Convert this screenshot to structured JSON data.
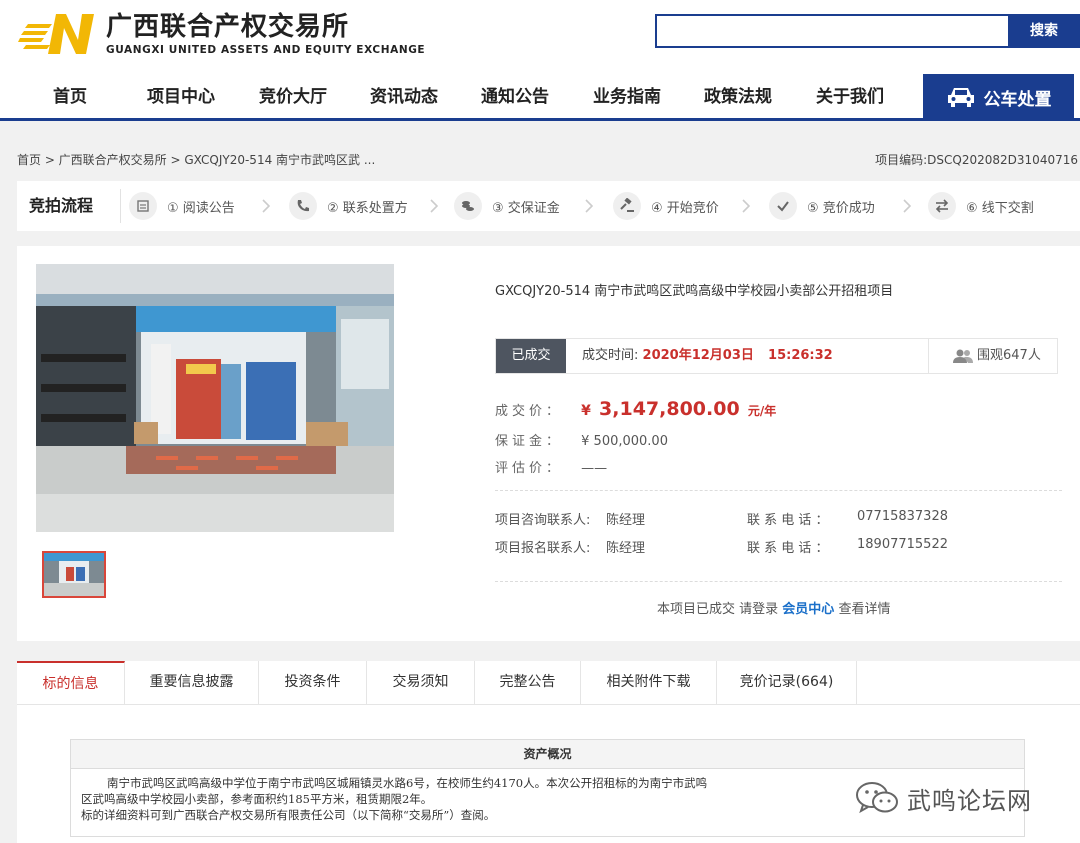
{
  "header": {
    "logo_cn": "广西联合产权交易所",
    "logo_en": "GUANGXI UNITED ASSETS AND EQUITY EXCHANGE",
    "search_placeholder": "",
    "search_button": "搜索"
  },
  "nav": {
    "items": [
      "首页",
      "项目中心",
      "竞价大厅",
      "资讯动态",
      "通知公告",
      "业务指南",
      "政策法规",
      "关于我们"
    ],
    "special": "公车处置"
  },
  "breadcrumb": "首页 > 广西联合产权交易所 > GXCQJY20-514 南宁市武鸣区武 ...",
  "project_code": "项目编码:DSCQ202082D31040716",
  "process": {
    "title": "竞拍流程",
    "steps": [
      "① 阅读公告",
      "② 联系处置方",
      "③ 交保证金",
      "④ 开始竞价",
      "⑤ 竞价成功",
      "⑥ 线下交割"
    ]
  },
  "project": {
    "title": "GXCQJY20-514 南宁市武鸣区武鸣高级中学校园小卖部公开招租项目",
    "status": "已成交",
    "deal_time_label": "成交时间:",
    "deal_date": "2020年12月03日",
    "deal_clock": "15:26:32",
    "views": "围观647人",
    "price_label": "成交价：",
    "price_symbol": "¥",
    "price": "3,147,800.00",
    "price_unit": "元/年",
    "deposit_label": "保证金：",
    "deposit": "¥ 500,000.00",
    "estimate_label": "评估价：",
    "estimate": "——",
    "consult_label": "项目咨询联系人:",
    "consult_name": "陈经理",
    "consult_phone_label": "联 系 电 话 ：",
    "consult_phone": "07715837328",
    "signup_label": "项目报名联系人:",
    "signup_name": "陈经理",
    "signup_phone_label": "联 系 电 话 ：",
    "signup_phone": "18907715522",
    "notice_pre": "本项目已成交 请登录",
    "notice_link": "会员中心",
    "notice_post": "查看详情"
  },
  "tabs": [
    "标的信息",
    "重要信息披露",
    "投资条件",
    "交易须知",
    "完整公告",
    "相关附件下载",
    "竞价记录(664)"
  ],
  "asset": {
    "heading": "资产概况",
    "line1": "南宁市武鸣区武鸣高级中学位于南宁市武鸣区城厢镇灵水路6号，在校师生约4170人。本次公开招租标的为南宁市武鸣",
    "line2": "区武鸣高级中学校园小卖部，参考面积约185平方米，租赁期限2年。",
    "line3": "标的详细资料可到广西联合产权交易所有限责任公司（以下简称“交易所”）查阅。"
  },
  "watermark": "武鸣论坛网",
  "colors": {
    "brand_blue": "#1a3d8f",
    "accent_red": "#c9302c",
    "logo_yellow": "#f2b705"
  }
}
